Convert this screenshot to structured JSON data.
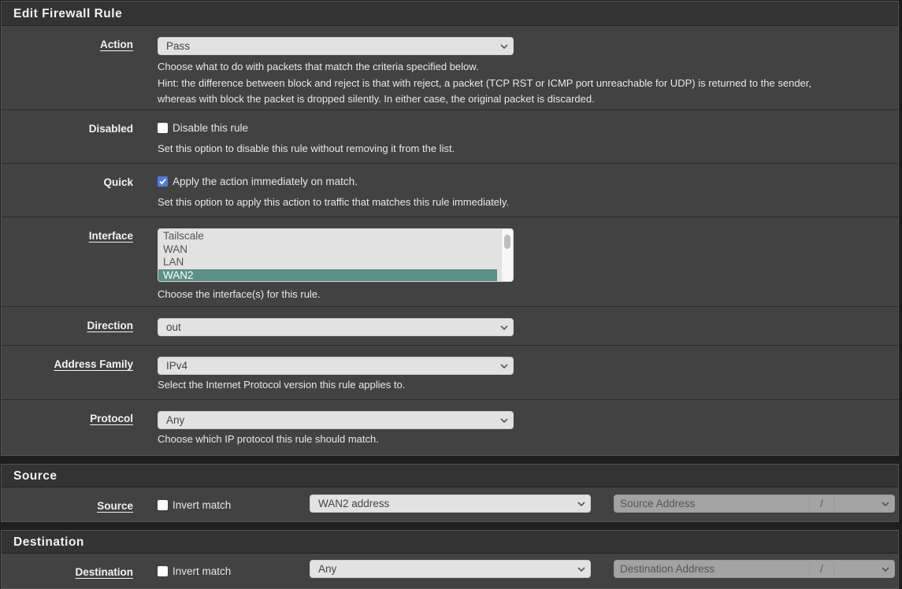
{
  "edit_panel": {
    "title": "Edit Firewall Rule",
    "action": {
      "label": "Action",
      "value": "Pass",
      "help_1": "Choose what to do with packets that match the criteria specified below.",
      "help_2": "Hint: the difference between block and reject is that with reject, a packet (TCP RST or ICMP port unreachable for UDP) is returned to the sender,",
      "help_3": "whereas with block the packet is dropped silently. In either case, the original packet is discarded."
    },
    "disabled": {
      "label": "Disabled",
      "checkbox_label": "Disable this rule",
      "checked": false,
      "help": "Set this option to disable this rule without removing it from the list."
    },
    "quick": {
      "label": "Quick",
      "checkbox_label": "Apply the action immediately on match.",
      "checked": true,
      "help": "Set this option to apply this action to traffic that matches this rule immediately."
    },
    "interface": {
      "label": "Interface",
      "options": [
        "Tailscale",
        "WAN",
        "LAN",
        "WAN2"
      ],
      "selected": "WAN2",
      "help": "Choose the interface(s) for this rule."
    },
    "direction": {
      "label": "Direction",
      "value": "out"
    },
    "address_family": {
      "label": "Address Family",
      "value": "IPv4",
      "help": "Select the Internet Protocol version this rule applies to."
    },
    "protocol": {
      "label": "Protocol",
      "value": "Any",
      "help": "Choose which IP protocol this rule should match."
    }
  },
  "source_panel": {
    "title": "Source",
    "label": "Source",
    "invert_label": "Invert match",
    "invert_checked": false,
    "type_value": "WAN2 address",
    "address_placeholder": "Source Address",
    "slash": "/",
    "mask_value": ""
  },
  "destination_panel": {
    "title": "Destination",
    "label": "Destination",
    "invert_label": "Invert match",
    "invert_checked": false,
    "type_value": "Any",
    "address_placeholder": "Destination Address",
    "slash": "/",
    "mask_value": ""
  },
  "colors": {
    "panel_bg": "#424242",
    "heading_bg": "#333333",
    "selected_option": "#5b9189",
    "checkbox_checked": "#4d7be6"
  }
}
